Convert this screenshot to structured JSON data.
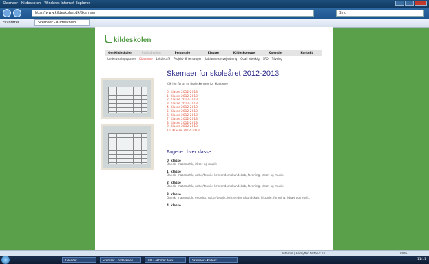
{
  "window": {
    "title": "Skemaer - Kildeskolen - Windows Internet Explorer"
  },
  "browser": {
    "address": "http://www.kildeskolen.dk/Skemaer",
    "search_placeholder": "Bing",
    "favorites_label": "Favoritter",
    "tab_label": "Skemaer - Kildeskolen"
  },
  "site": {
    "logo_text": "kildeskolen",
    "topnav": [
      "Om Kildeskolen",
      "Indskrivning",
      "Personale",
      "Klasser",
      "Kildeskolespel",
      "Kalender",
      "Kontakt"
    ],
    "subnav": [
      "Undervisningsplaner",
      "Klasserne",
      "Lektiecafé",
      "Projekt- & temauger",
      "Uddannelsesvejledning",
      "Quali efteskig",
      "SFO",
      "Trivsing"
    ],
    "subnav_active_index": 1
  },
  "content": {
    "heading": "Skemaer for skoleåret 2012-2013",
    "intro": "Klik her for at se skoleskemaer for klasserne",
    "class_links": [
      "0. Klasse 2012-2013",
      "1. Klasse 2012-2013",
      "2. Klasse 2012-2013",
      "3. Klasse 2012-2013",
      "4. Klasse 2012-2013",
      "5. Klasse 2012-2013",
      "6. Klasse 2012-2013",
      "7. Klasse 2012-2013",
      "8. Klasse 2012-2013",
      "9. Klasse 2012-2013",
      "10. Klasse 2012-2013"
    ],
    "subjects_heading": "Fagene i hver klasse",
    "subjects": [
      {
        "title": "0. klasse",
        "desc": "Dansk, matematik, idræt og musik"
      },
      {
        "title": "1. klasse",
        "desc": "Dansk, matematik, natur/teknik, kristendomskundskab, forening, idræt og musik."
      },
      {
        "title": "2. klasse",
        "desc": "Dansk, matematik, natur/teknik, kristendomskundskab, forening, idræt og musik."
      },
      {
        "title": "3. klasse",
        "desc": "Dansk, matematik, engelsk, natur/teknik, kristendomskundskab, historie, forening, idræt og musik."
      },
      {
        "title": "4. klasse",
        "desc": ""
      }
    ]
  },
  "statusbar": {
    "zone": "Internet | Beskyttet tilstand: Til",
    "zoom": "100%"
  },
  "taskbar": {
    "buttons": [
      "Kalender",
      "Skemaer - Kildeskolen",
      "2012 oktober.docx",
      "Skemaer - Kildesk..."
    ],
    "clock": "11:11"
  }
}
